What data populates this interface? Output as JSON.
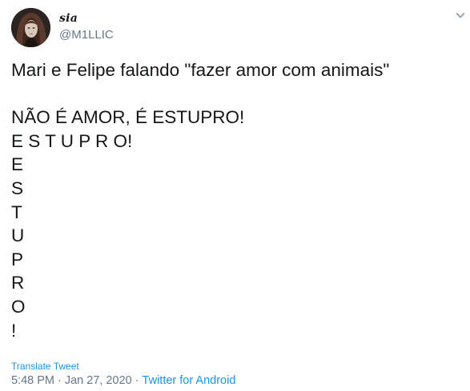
{
  "user": {
    "display_name": "sia",
    "handle": "@M1LLIC"
  },
  "tweet": {
    "text": "Mari e Felipe falando \"fazer amor com animais\"\n\nNÃO É AMOR, É ESTUPRO!\nE S T U P R O!\nE\nS\nT\nU\nP\nR\nO\n!"
  },
  "actions": {
    "translate_label": "Translate Tweet",
    "more_icon": "chevron-down-icon"
  },
  "meta": {
    "time": "5:48 PM",
    "separator": "·",
    "date": "Jan 27, 2020",
    "client": "Twitter for Android"
  },
  "colors": {
    "text": "#14171a",
    "secondary": "#657786",
    "link": "#1b95e0",
    "background": "#ffffff"
  }
}
